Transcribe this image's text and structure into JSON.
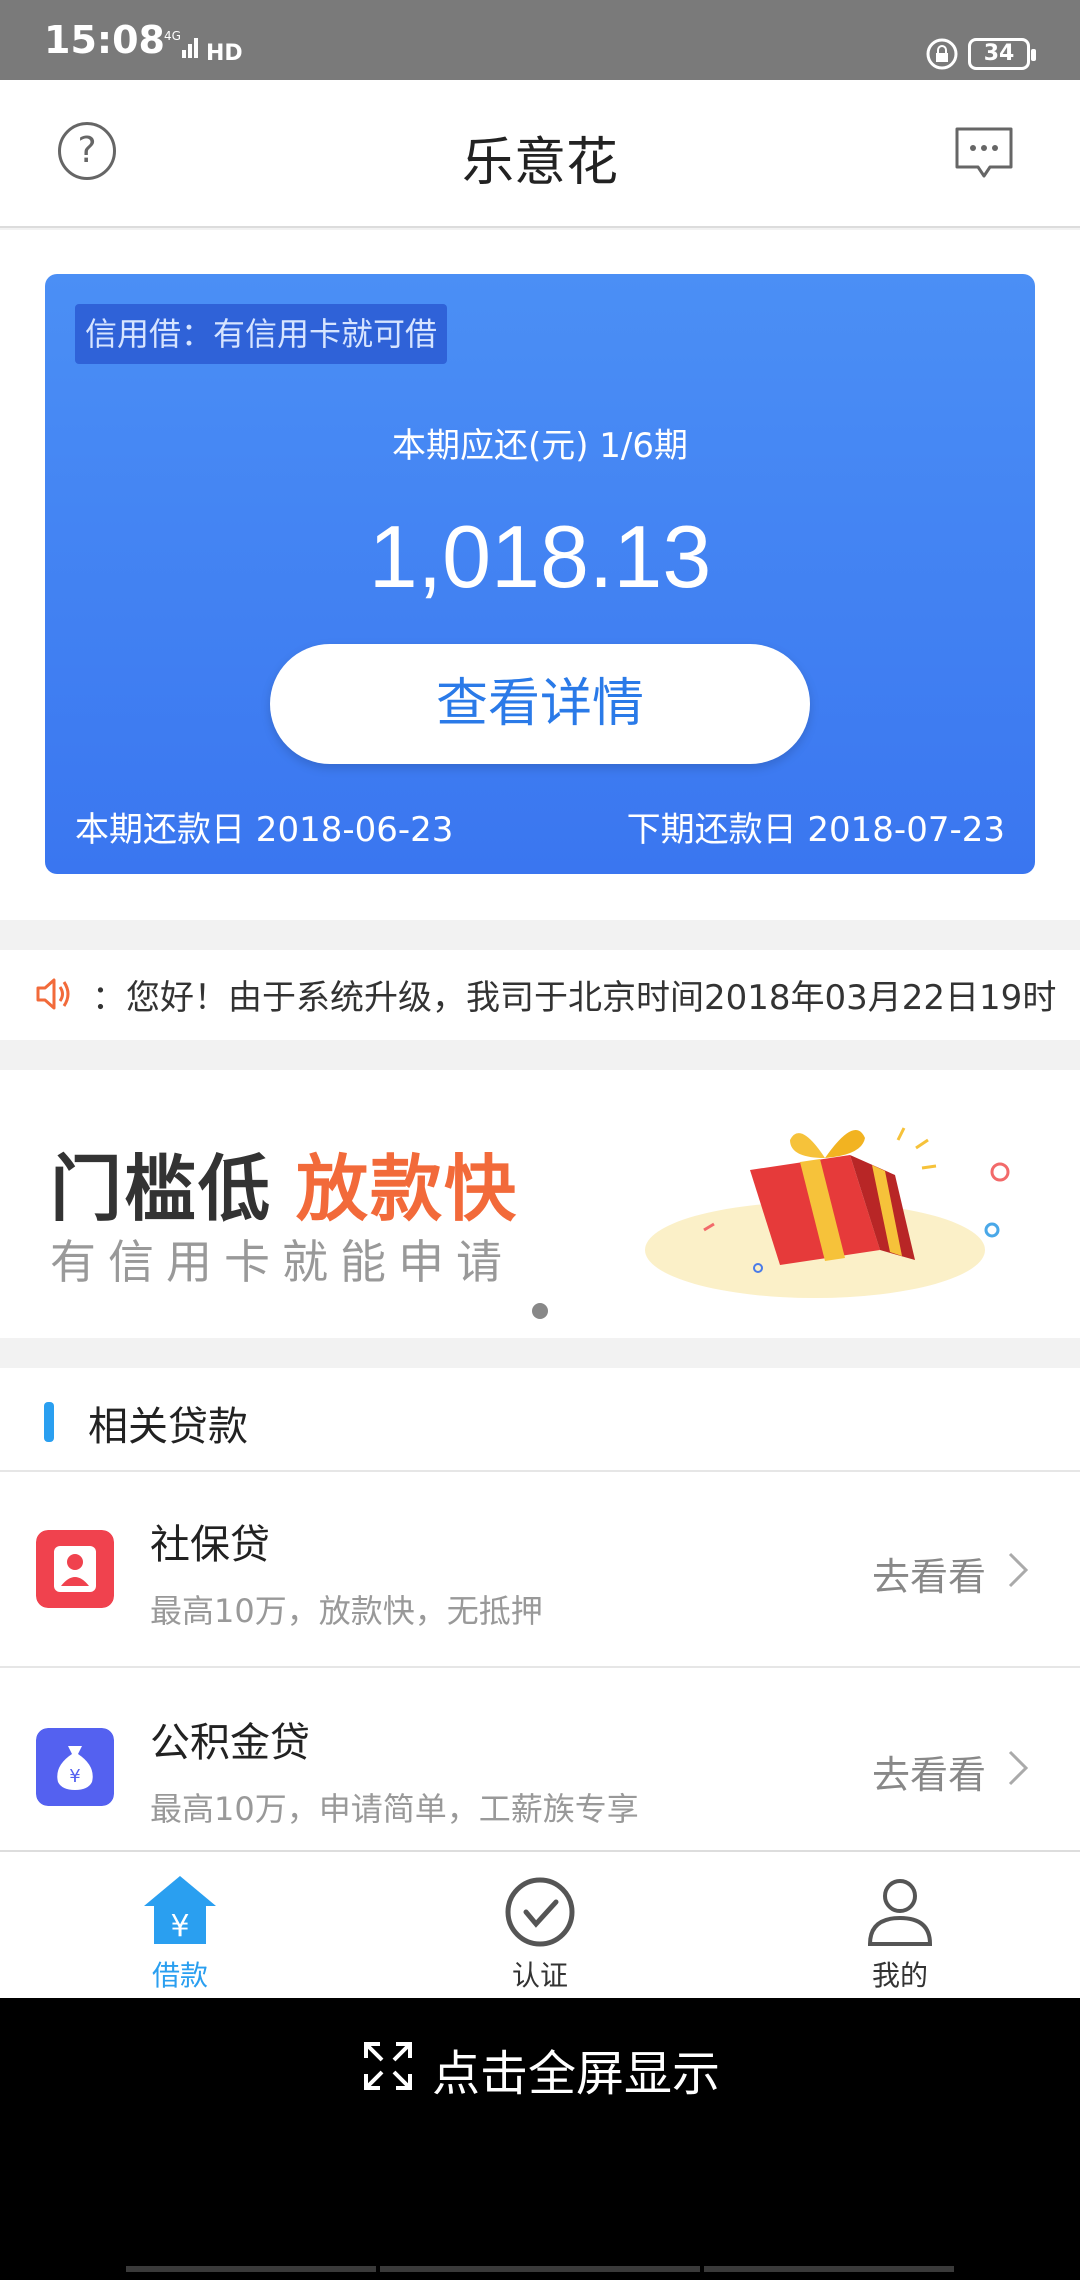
{
  "status_bar": {
    "time": "15:08",
    "battery": "34"
  },
  "header": {
    "title": "乐意花"
  },
  "loan_card": {
    "tag": "信用借：有信用卡就可借",
    "period_label": "本期应还(元) 1/6期",
    "amount": "1,018.13",
    "detail_button": "查看详情",
    "due_current": "本期还款日 2018-06-23",
    "due_next": "下期还款日 2018-07-23"
  },
  "notice": {
    "text": "：您好！由于系统升级，我司于北京时间2018年03月22日19时"
  },
  "banner": {
    "headline_main": "门槛低",
    "headline_accent": "放款快",
    "subline": "有信用卡就能申请"
  },
  "related": {
    "title": "相关贷款",
    "items": [
      {
        "name": "社保贷",
        "desc": "最高10万，放款快，无抵押",
        "action": "去看看",
        "icon": "person-card-icon",
        "color": "#f0424e"
      },
      {
        "name": "公积金贷",
        "desc": "最高10万，申请简单，工薪族专享",
        "action": "去看看",
        "icon": "money-bag-icon",
        "color": "#5461f0"
      }
    ]
  },
  "tabs": [
    {
      "label": "借款",
      "icon": "home-yen-icon",
      "active": true
    },
    {
      "label": "认证",
      "icon": "check-circle-icon",
      "active": false
    },
    {
      "label": "我的",
      "icon": "user-icon",
      "active": false
    }
  ],
  "fullscreen": {
    "label": "点击全屏显示"
  },
  "colors": {
    "accent": "#2a9ff0",
    "card": "#3a76f0",
    "banner_accent": "#f26a3a"
  }
}
